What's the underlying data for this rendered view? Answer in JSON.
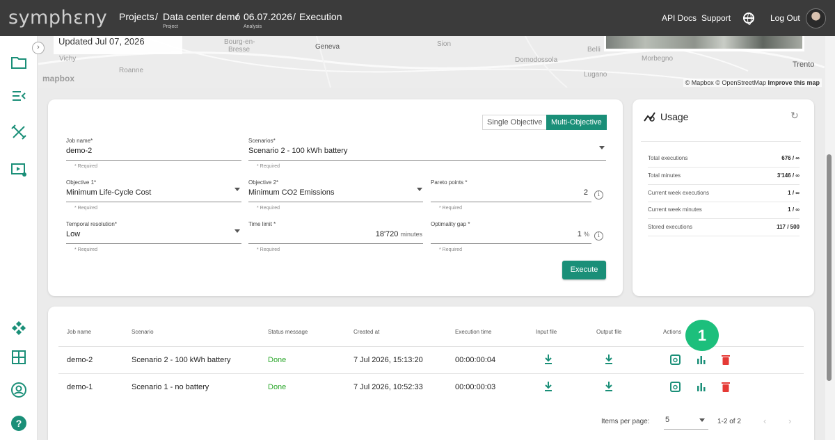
{
  "app": {
    "logo": "symphεny"
  },
  "breadcrumb": {
    "project": "Projects",
    "project_sub": "Project",
    "analysis": "Data center demo",
    "analysis_sub": "Analysis",
    "date": "06.07.2026",
    "page": "Execution",
    "separator": "/"
  },
  "header": {
    "api_docs": "API Docs",
    "support": "Support",
    "logout": "Log Out"
  },
  "map": {
    "updated": "Updated Jul 07, 2026",
    "labels": [
      "Bourg-en-",
      "Bresse",
      "Geneva",
      "Roanne",
      "Vichy",
      "Sion",
      "Domodossola",
      "Lugano",
      "Morbegno",
      "Trento",
      "Belli"
    ],
    "logo": "mapbox",
    "attribution": "© Mapbox © OpenStreetMap",
    "improve": "Improve this map"
  },
  "form": {
    "toggle_single": "Single Objective",
    "toggle_multi": "Multi-Objective",
    "job_name": {
      "label": "Job name*",
      "value": "demo-2"
    },
    "scenarios": {
      "label": "Scenarios*",
      "value": "Scenario 2 - 100 kWh battery"
    },
    "objective1": {
      "label": "Objective 1*",
      "value": "Minimum Life-Cycle Cost"
    },
    "objective2": {
      "label": "Objective 2*",
      "value": "Minimum CO2 Emissions"
    },
    "pareto": {
      "label": "Pareto points *",
      "value": "2"
    },
    "temporal": {
      "label": "Temporal resolution*",
      "value": "Low"
    },
    "time_limit": {
      "label": "Time limit *",
      "value": "18'720",
      "unit": "minutes"
    },
    "optimality": {
      "label": "Optimality gap *",
      "value": "1",
      "unit": "%"
    },
    "required": "* Required",
    "info_symbol": "i",
    "execute": "Execute"
  },
  "usage": {
    "title": "Usage",
    "rows": [
      {
        "label": "Total executions",
        "value": "676 / ∞"
      },
      {
        "label": "Total minutes",
        "value": "3'146 / ∞"
      },
      {
        "label": "Current week executions",
        "value": "1 / ∞"
      },
      {
        "label": "Current week minutes",
        "value": "1 / ∞"
      },
      {
        "label": "Stored executions",
        "value": "117 / 500"
      }
    ]
  },
  "table": {
    "headers": [
      "Job name",
      "Scenario",
      "Status message",
      "Created at",
      "Execution time",
      "Input file",
      "Output file",
      "Actions"
    ],
    "rows": [
      {
        "job": "demo-2",
        "scenario": "Scenario 2 - 100 kWh battery",
        "status": "Done",
        "created": "7 Jul 2026, 15:13:20",
        "time": "00:00:00:04"
      },
      {
        "job": "demo-1",
        "scenario": "Scenario 1 - no battery",
        "status": "Done",
        "created": "7 Jul 2026, 10:52:33",
        "time": "00:00:00:03"
      }
    ],
    "badge": "1"
  },
  "pagination": {
    "items_label": "Items per page:",
    "per_page": "5",
    "range": "1-2 of 2"
  },
  "colors": {
    "accent": "#1a8f78",
    "done": "#2ba72b",
    "delete": "#e53935",
    "badge": "#1cbf7c"
  }
}
